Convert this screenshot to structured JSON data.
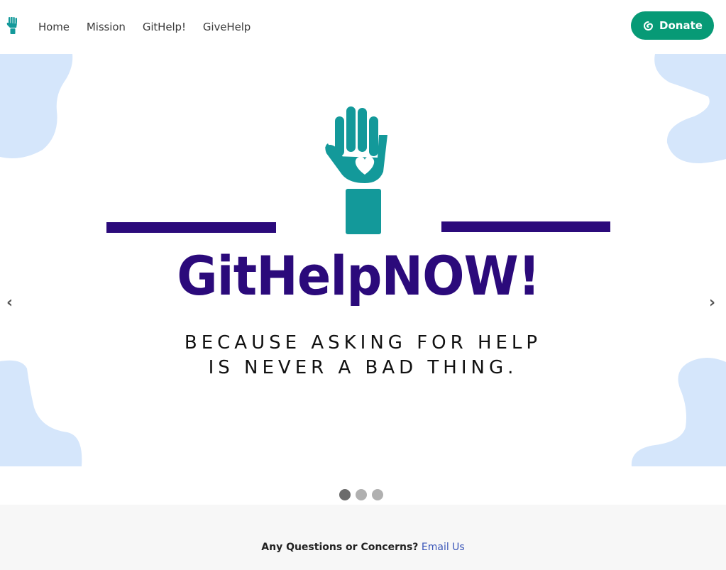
{
  "nav": {
    "brand_icon": "raised-hand-heart-icon",
    "links": [
      "Home",
      "Mission",
      "GitHelp!",
      "GiveHelp"
    ],
    "donate_label": "Donate",
    "donate_icon": "spiral-icon"
  },
  "carousel": {
    "logo_text": "GitHelpNOW!",
    "tagline_line1": "BECAUSE ASKING FOR HELP",
    "tagline_line2": "IS NEVER A BAD THING.",
    "prev_label": "‹",
    "next_label": "›",
    "slide_count": 3,
    "active_slide": 1
  },
  "footer": {
    "question": "Any Questions or Concerns?",
    "link_label": "Email Us"
  },
  "colors": {
    "accent": "#079a76",
    "brand_purple": "#2b0a7b",
    "brand_teal": "#13999a",
    "blob": "#d5e6fb"
  }
}
